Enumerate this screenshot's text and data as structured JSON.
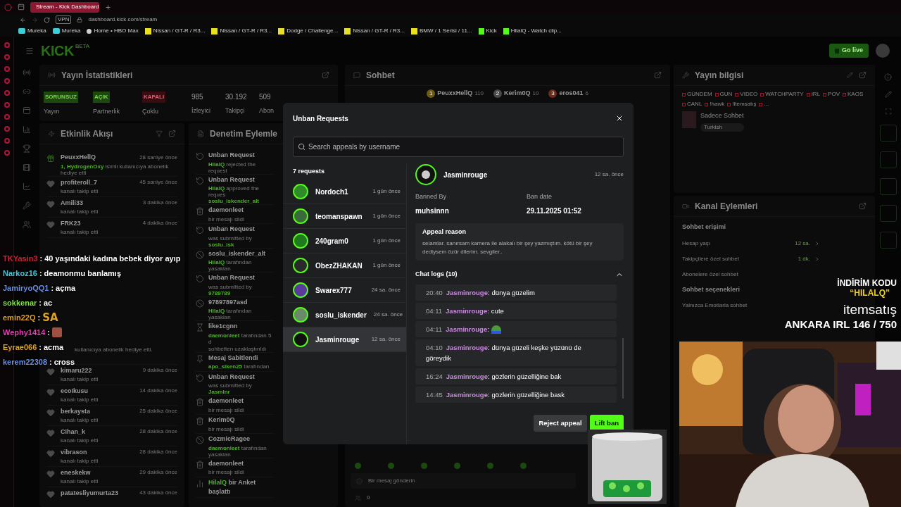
{
  "browser": {
    "tab_title": "Stream - Kick Dashboard",
    "vpn": "VPN",
    "url": "dashboard.kick.com/stream",
    "bookmarks": [
      {
        "label": "Mureka",
        "kind": "mureka"
      },
      {
        "label": "Mureka",
        "kind": "mureka"
      },
      {
        "label": "Home • HBO Max",
        "kind": "hbo"
      },
      {
        "label": "Nissan / GT-R / R3...",
        "kind": "s"
      },
      {
        "label": "Nissan / GT-R / R3...",
        "kind": "s"
      },
      {
        "label": "Dodge / Challenge...",
        "kind": "s"
      },
      {
        "label": "Nissan / GT-R / R3...",
        "kind": "s"
      },
      {
        "label": "BMW / 1 Serisi / 11...",
        "kind": "s"
      },
      {
        "label": "Kick",
        "kind": "kick"
      },
      {
        "label": "HilalQ - Watch clip...",
        "kind": "kick"
      }
    ]
  },
  "header": {
    "logo": "KICK",
    "logo_badge": "BETA",
    "go_live": "Go live"
  },
  "stats": {
    "title": "Yayın İstatistikleri",
    "statuses": [
      {
        "badge": "SORUNSUZ",
        "caption": "Yayın",
        "kind": "ok"
      },
      {
        "badge": "AÇIK",
        "caption": "Partnerlik",
        "kind": "ok"
      },
      {
        "badge": "KAPALI",
        "caption": "Çoklu",
        "kind": "off"
      }
    ],
    "numbers": [
      {
        "value": "985",
        "label": "İzleyici"
      },
      {
        "value": "30.192",
        "label": "Takipçi"
      },
      {
        "value": "509",
        "label": "Abon"
      }
    ]
  },
  "activity": {
    "title": "Etkinlik Akışı",
    "items": [
      {
        "kind": "gift",
        "name": "PeuxxHellQ",
        "time": "28 saniye önce",
        "actor": "1, HydrogenOxy",
        "text": "isimli kullanıcıya abonelik hediye etti"
      },
      {
        "kind": "follow",
        "name": "profiteroll_7",
        "time": "45 saniye önce",
        "text": "kanalı takip etti"
      },
      {
        "kind": "follow",
        "name": "Amili33",
        "time": "3 dakika önce",
        "text": "kanalı takip etti"
      },
      {
        "kind": "follow",
        "name": "FRK23",
        "time": "4 dakika önce",
        "text": "kanalı takip etti"
      },
      {
        "kind": "gift_bulk",
        "text": "kullanıcıya abonelik hediye etti."
      },
      {
        "kind": "follow",
        "name": "kimaru222",
        "time": "9 dakika önce",
        "text": "kanalı takip etti"
      },
      {
        "kind": "follow",
        "name": "ecoIkusu",
        "time": "14 dakika önce",
        "text": "kanalı takip etti"
      },
      {
        "kind": "follow",
        "name": "berkaysta",
        "time": "25 dakika önce",
        "text": "kanalı takip etti"
      },
      {
        "kind": "follow",
        "name": "Cihan_k",
        "time": "28 dakika önce",
        "text": "kanalı takip etti"
      },
      {
        "kind": "follow",
        "name": "vibrason",
        "time": "28 dakika önce",
        "text": "kanalı takip etti"
      },
      {
        "kind": "follow",
        "name": "eneskekw",
        "time": "29 dakika önce",
        "text": "kanalı takip etti"
      },
      {
        "kind": "follow",
        "name": "patatesliyumurta23",
        "time": "43 dakika önce"
      }
    ]
  },
  "moderation": {
    "title": "Denetim Eylemle",
    "items": [
      {
        "kind": "unban",
        "title": "Unban Request",
        "actor": "HilalQ",
        "text": "rejected the request"
      },
      {
        "kind": "unban",
        "title": "Unban Request",
        "actor": "HilalQ",
        "text": "approved the reques",
        "target": "soslu_iskender_alt"
      },
      {
        "kind": "delete",
        "title": "daemonleet",
        "text": "bir mesajı sildi"
      },
      {
        "kind": "unban",
        "title": "Unban Request",
        "text": "was submitted by",
        "target": "soslu_isk"
      },
      {
        "kind": "ban",
        "title": "soslu_iskender_alt",
        "actor": "HilalQ",
        "text": "tarafından yasaklan"
      },
      {
        "kind": "unban",
        "title": "Unban Request",
        "text": "was submitted by",
        "target": "9789789"
      },
      {
        "kind": "ban",
        "title": "97897897asd",
        "actor": "HilalQ",
        "text": "tarafından yasaklan"
      },
      {
        "kind": "timeout",
        "title": "like1cgnn",
        "actor": "daemonleet",
        "text": "tarafından 5 d",
        "note": "sohbetten uzaklaştırıldı"
      },
      {
        "kind": "pin",
        "title": "Mesaj Sabitlendi",
        "actor": "apo_siken25",
        "text": "tarafından"
      },
      {
        "kind": "unban",
        "title": "Unban Request",
        "text": "was submitted by",
        "target": "Jasminr"
      },
      {
        "kind": "delete",
        "title": "daemonleet",
        "text": "bir mesajı sildi"
      },
      {
        "kind": "delete",
        "title": "Kerim0Q",
        "text": "bir mesajı sildi"
      },
      {
        "kind": "ban",
        "title": "CozmicRagee",
        "actor": "daemonleet",
        "text": "tarafından yasaklan"
      },
      {
        "kind": "delete",
        "title": "daemonleet",
        "text": "bir mesajı sildi"
      },
      {
        "kind": "poll",
        "actor": "HilalQ",
        "text": "bir Anket başlattı"
      }
    ]
  },
  "chat": {
    "title": "Sohbet",
    "leaders": [
      {
        "rank": "1",
        "name": "PeuxxHellQ",
        "count": "110",
        "color": "#6b5a12"
      },
      {
        "rank": "2",
        "name": "Kerim0Q",
        "count": "10",
        "color": "#4a4a4a"
      },
      {
        "rank": "3",
        "name": "eros041",
        "count": "6",
        "color": "#6b2a1a"
      }
    ],
    "placeholder": "Bir mesaj gönderin",
    "count": "0"
  },
  "stream_info": {
    "title": "Yayın bilgisi",
    "tags": [
      "GÜNDEM",
      "GUN",
      "VIDEO",
      "WATCHPARTY",
      "IRL",
      "POV",
      "KAOS",
      "CANL",
      "!hawk",
      "!itemsatış",
      "..."
    ],
    "category": "Sadece Sohbet",
    "language": "Turkish"
  },
  "channel_actions": {
    "title": "Kanal Eylemleri",
    "sections": [
      {
        "title": "Sohbet erişimi",
        "rows": [
          {
            "label": "Hesap yaşı",
            "value": "12 sa."
          },
          {
            "label": "Takipçilere özel sohbet",
            "value": "1 dk."
          },
          {
            "label": "Abonelere özel sohbet"
          }
        ]
      },
      {
        "title": "Sohbet seçenekleri",
        "rows": [
          {
            "label": "Yalnızca Emotlarla sohbet"
          }
        ]
      }
    ]
  },
  "overlay_separator": ":",
  "overlay_chat": [
    {
      "name": "TKYasin3",
      "color": "#d0203a",
      "text": "40 yaşındaki kadına bebek diyor ayıp"
    },
    {
      "name": "Narkoz16",
      "color": "#3ec8d8",
      "text": "deamonmu banlamış"
    },
    {
      "name": "JamiryoQQ1",
      "color": "#6a8fe0",
      "text": "açma"
    },
    {
      "name": "sokkenar",
      "color": "#7ee04a",
      "text": "ac"
    },
    {
      "name": "emin22Q",
      "color": "#e0a020",
      "text": "SA",
      "kind": "big"
    },
    {
      "name": "Wephy1414",
      "color": "#e040b0",
      "kind": "emote"
    },
    {
      "name": "Eyrae066",
      "color": "#e0a020",
      "text": "acma"
    },
    {
      "name": "kerem22308",
      "color": "#6a8fe0",
      "text": "cross"
    }
  ],
  "promo": {
    "code_label": "İNDİRİM KODU",
    "code": "“HILALQ”",
    "brand": "itemsatış",
    "counter": "ANKARA IRL 146 / 750"
  },
  "modal": {
    "title": "Unban Requests",
    "search_placeholder": "Search appeals by username",
    "count": "7 requests",
    "requests": [
      {
        "name": "Nordoch1",
        "time": "1 gün önce",
        "selected": false,
        "color": "#2f8a2a"
      },
      {
        "name": "teomanspawn",
        "time": "1 gün önce",
        "selected": false,
        "color": "#3a6a3a"
      },
      {
        "name": "240gram0",
        "time": "1 gün önce",
        "selected": false,
        "color": "#1f7a1f"
      },
      {
        "name": "ObezZHAKAN",
        "time": "1 gün önce",
        "selected": false,
        "color": "#2a2a2a"
      },
      {
        "name": "Swarex777",
        "time": "24 sa. önce",
        "selected": false,
        "color": "#5a3a9a"
      },
      {
        "name": "soslu_iskender",
        "time": "24 sa. önce",
        "selected": false,
        "color": "#6a8a6a"
      },
      {
        "name": "Jasminrouge",
        "time": "12 sa. önce",
        "selected": true,
        "color": "#111111"
      }
    ],
    "detail": {
      "name": "Jasminrouge",
      "time": "12 sa. önce",
      "banned_by_label": "Banned By",
      "banned_by": "muhsinnn",
      "ban_date_label": "Ban date",
      "ban_date": "29.11.2025 01:52",
      "reason_title": "Appeal reason",
      "reason": "selamlar. sanırsam kamera ile alakalı bir şey yazmıştım. kötü bir şey dediysem özür dilerim. sevgiler..",
      "logs_title": "Chat logs (10)",
      "logs_expanded": true,
      "separator": ":",
      "logs": [
        {
          "time": "20:40",
          "user": "Jasminrouge",
          "text": "dünya güzelim",
          "kind": "text"
        },
        {
          "time": "04:11",
          "user": "Jasminrouge",
          "text": "cute",
          "kind": "text"
        },
        {
          "time": "04:11",
          "user": "Jasminrouge",
          "kind": "emote"
        },
        {
          "time": "04:10",
          "user": "Jasminrouge",
          "text": "dünya güzeli keşke yüzünü de göreydik",
          "kind": "text"
        },
        {
          "time": "16:24",
          "user": "Jasminrouge",
          "text": "gözlerin güzelliğine bak",
          "kind": "text"
        },
        {
          "time": "14:45",
          "user": "Jasminrouge",
          "text": "gözlerin güzelliğine bask",
          "kind": "text"
        }
      ]
    },
    "reject": "Reject appeal",
    "lift": "Lift ban"
  }
}
